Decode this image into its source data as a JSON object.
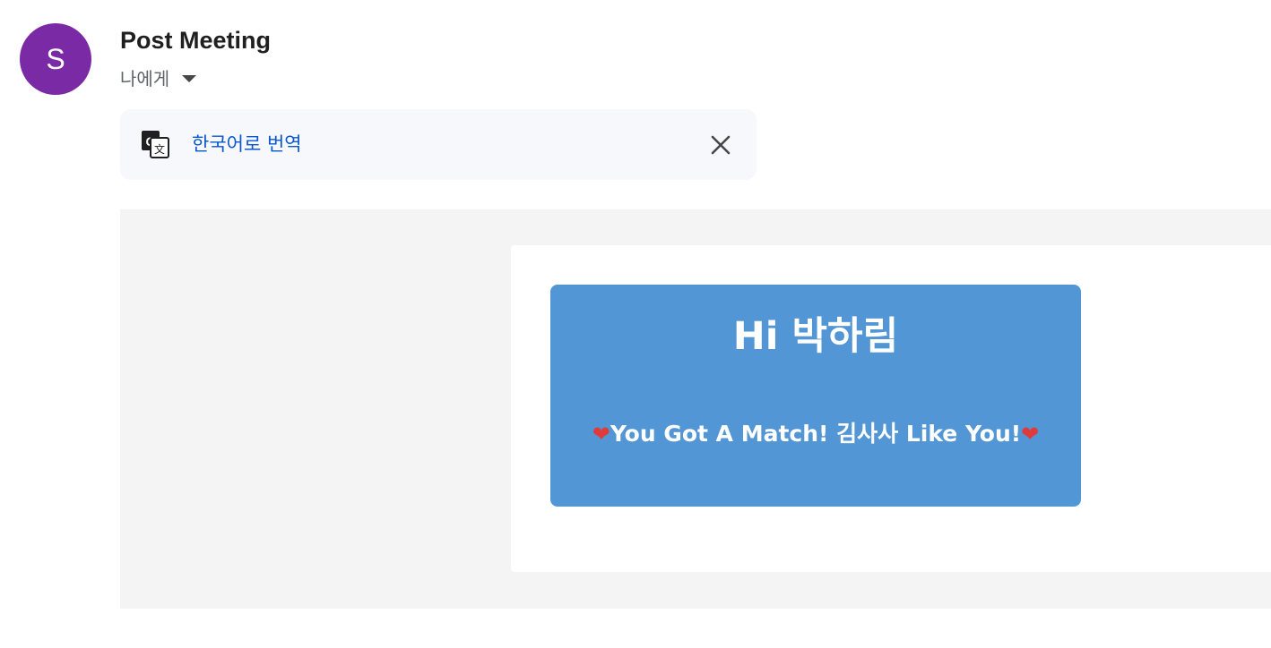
{
  "sender": {
    "avatar_letter": "S",
    "avatar_color": "#7b2aa6"
  },
  "header": {
    "subject": "Post Meeting",
    "recipient": "나에게"
  },
  "translate_bar": {
    "icon": "translate-icon",
    "link_label": "한국어로 번역",
    "close_icon": "close-icon",
    "link_color": "#0b57d0"
  },
  "email_body": {
    "greeting": "Hi 박하림",
    "heart_left": "❤",
    "match_message": "You Got A Match! 김사사 Like You!",
    "heart_right": "❤",
    "box_color": "#5296d5"
  }
}
